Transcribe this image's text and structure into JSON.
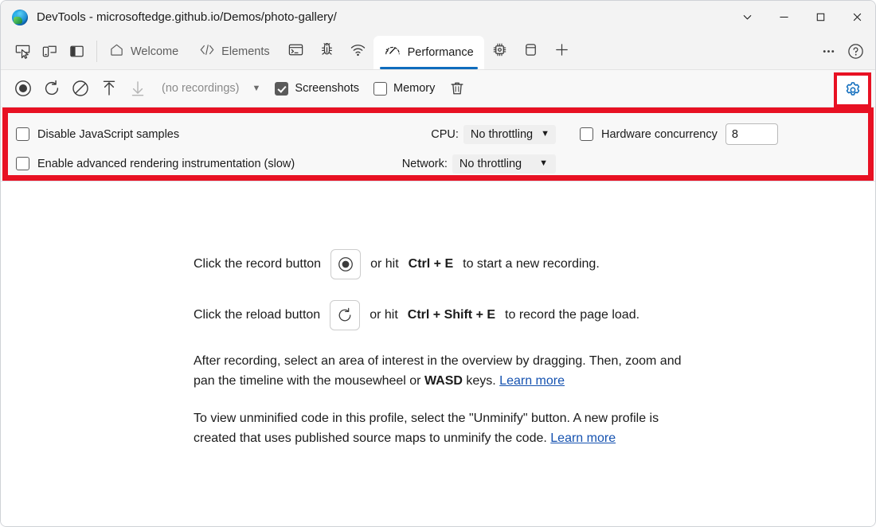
{
  "window": {
    "title": "DevTools - microsoftedge.github.io/Demos/photo-gallery/",
    "controls": {
      "more": "∨",
      "minimize": "—",
      "maximize": "□",
      "close": "✕"
    }
  },
  "toolstrip": {
    "left_icons": [
      {
        "name": "inspect-element-icon",
        "label": "Inspect element"
      },
      {
        "name": "device-emulation-icon",
        "label": "Toggle device emulation"
      },
      {
        "name": "dock-side-icon",
        "label": "Dock side"
      }
    ],
    "tabs": [
      {
        "id": "welcome",
        "label": "Welcome",
        "icon": "home-icon",
        "active": false
      },
      {
        "id": "elements",
        "label": "Elements",
        "icon": "code-icon",
        "active": false
      },
      {
        "id": "console",
        "label": "",
        "icon": "console-icon",
        "active": false
      },
      {
        "id": "sources",
        "label": "",
        "icon": "bug-icon",
        "active": false
      },
      {
        "id": "network",
        "label": "",
        "icon": "network-icon",
        "active": false
      },
      {
        "id": "performance",
        "label": "Performance",
        "icon": "performance-icon",
        "active": true
      },
      {
        "id": "memory",
        "label": "",
        "icon": "memory-chip-icon",
        "active": false
      },
      {
        "id": "application",
        "label": "",
        "icon": "application-icon",
        "active": false
      },
      {
        "id": "more-tools",
        "label": "",
        "icon": "plus-icon",
        "active": false
      }
    ],
    "right_icons": [
      {
        "name": "more-options-icon",
        "label": "Customize and control DevTools"
      },
      {
        "name": "help-icon",
        "label": "Help"
      }
    ]
  },
  "recording_toolbar": {
    "record_icon": "record-icon",
    "reload_icon": "reload-record-icon",
    "clear_icon": "clear-icon",
    "upload_icon": "upload-profile-icon",
    "download_icon": "download-profile-icon",
    "recordings_label": "(no recordings)",
    "recordings_caret": "▼",
    "screenshots": {
      "label": "Screenshots",
      "checked": true
    },
    "memory": {
      "label": "Memory",
      "checked": false
    },
    "delete_icon": "trash-icon",
    "settings_gear": {
      "name": "capture-settings-gear-icon",
      "active": true,
      "highlight_color": "#e81123"
    }
  },
  "settings_panel": {
    "highlight_color": "#e81123",
    "disable_js_samples": {
      "label": "Disable JavaScript samples",
      "checked": false
    },
    "advanced_rendering": {
      "label": "Enable advanced rendering instrumentation (slow)",
      "checked": false
    },
    "cpu": {
      "label": "CPU:",
      "value": "No throttling",
      "arrow": "▼"
    },
    "network": {
      "label": "Network:",
      "value": "No throttling",
      "arrow": "▼"
    },
    "hardware_concurrency": {
      "label": "Hardware concurrency",
      "checked": false,
      "value": "8"
    }
  },
  "content": {
    "record_hint": {
      "before": "Click the record button",
      "mid": "or hit",
      "shortcut": "Ctrl + E",
      "after": "to start a new recording."
    },
    "reload_hint": {
      "before": "Click the reload button",
      "mid": "or hit",
      "shortcut": "Ctrl + Shift + E",
      "after": "to record the page load."
    },
    "paragraph_1": {
      "text_a": "After recording, select an area of interest in the overview by dragging. Then, zoom and pan the timeline with the mousewheel or ",
      "bold": "WASD",
      "text_b": " keys. ",
      "link": "Learn more"
    },
    "paragraph_2": {
      "text_a": "To view unminified code in this profile, select the \"Unminify\" button. A new profile is created that uses published source maps to unminify the code. ",
      "link": "Learn more"
    }
  }
}
